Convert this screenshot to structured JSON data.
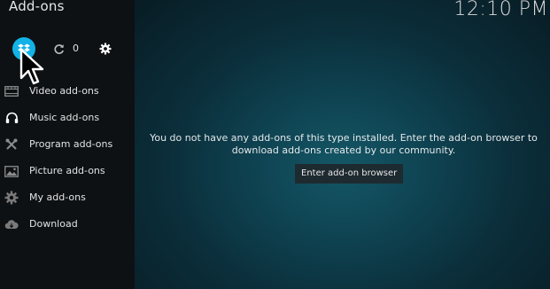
{
  "header": {
    "title": "Add-ons",
    "clock": "12:10 PM"
  },
  "toolbar": {
    "install_from_zip_icon": "dropbox-icon",
    "update_count": "0",
    "refresh_icon": "refresh-icon",
    "settings_icon": "gear-icon",
    "accent_color": "#12b2e7"
  },
  "sidebar": {
    "items": [
      {
        "label": "Video add-ons",
        "icon": "film-icon"
      },
      {
        "label": "Music add-ons",
        "icon": "headphones-icon"
      },
      {
        "label": "Program add-ons",
        "icon": "tools-icon"
      },
      {
        "label": "Picture add-ons",
        "icon": "picture-icon"
      },
      {
        "label": "My add-ons",
        "icon": "puzzle-gear-icon"
      },
      {
        "label": "Download",
        "icon": "cloud-download-icon"
      }
    ]
  },
  "main": {
    "message_line1": "You do not have any add-ons of this type installed. Enter the add-on browser to",
    "message_line2": "download add-ons created by our community.",
    "browser_button_label": "Enter add-on browser"
  }
}
